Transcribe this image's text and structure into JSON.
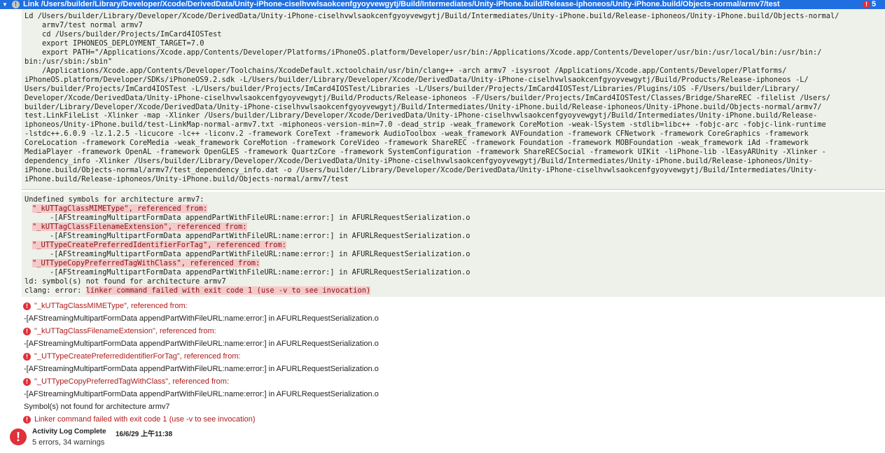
{
  "header": {
    "disclosure": "▼",
    "title": "Link /Users/builder/Library/Developer/Xcode/DerivedData/Unity-iPhone-ciselhvwlsaokcenfgyoyvewgytj/Build/Intermediates/Unity-iPhone.build/Release-iphoneos/Unity-iPhone.build/Objects-normal/armv7/test",
    "warning_glyph": "!",
    "error_glyph": "!",
    "error_count": "5"
  },
  "command_lines": [
    "Ld /Users/builder/Library/Developer/Xcode/DerivedData/Unity-iPhone-ciselhvwlsaokcenfgyoyvewgytj/Build/Intermediates/Unity-iPhone.build/Release-iphoneos/Unity-iPhone.build/Objects-normal/",
    "    armv7/test normal armv7",
    "    cd /Users/builder/Projects/ImCard4IOSTest",
    "    export IPHONEOS_DEPLOYMENT_TARGET=7.0",
    "    export PATH=\"/Applications/Xcode.app/Contents/Developer/Platforms/iPhoneOS.platform/Developer/usr/bin:/Applications/Xcode.app/Contents/Developer/usr/bin:/usr/local/bin:/usr/bin:/",
    "bin:/usr/sbin:/sbin\"",
    "    /Applications/Xcode.app/Contents/Developer/Toolchains/XcodeDefault.xctoolchain/usr/bin/clang++ -arch armv7 -isysroot /Applications/Xcode.app/Contents/Developer/Platforms/",
    "iPhoneOS.platform/Developer/SDKs/iPhoneOS9.2.sdk -L/Users/builder/Library/Developer/Xcode/DerivedData/Unity-iPhone-ciselhvwlsaokcenfgyoyvewgytj/Build/Products/Release-iphoneos -L/",
    "Users/builder/Projects/ImCard4IOSTest -L/Users/builder/Projects/ImCard4IOSTest/Libraries -L/Users/builder/Projects/ImCard4IOSTest/Libraries/Plugins/iOS -F/Users/builder/Library/",
    "Developer/Xcode/DerivedData/Unity-iPhone-ciselhvwlsaokcenfgyoyvewgytj/Build/Products/Release-iphoneos -F/Users/builder/Projects/ImCard4IOSTest/Classes/Bridge/ShareREC -filelist /Users/",
    "builder/Library/Developer/Xcode/DerivedData/Unity-iPhone-ciselhvwlsaokcenfgyoyvewgytj/Build/Intermediates/Unity-iPhone.build/Release-iphoneos/Unity-iPhone.build/Objects-normal/armv7/",
    "test.LinkFileList -Xlinker -map -Xlinker /Users/builder/Library/Developer/Xcode/DerivedData/Unity-iPhone-ciselhvwlsaokcenfgyoyvewgytj/Build/Intermediates/Unity-iPhone.build/Release-",
    "iphoneos/Unity-iPhone.build/test-LinkMap-normal-armv7.txt -miphoneos-version-min=7.0 -dead_strip -weak_framework CoreMotion -weak-lSystem -stdlib=libc++ -fobjc-arc -fobjc-link-runtime",
    "-lstdc++.6.0.9 -lz.1.2.5 -licucore -lc++ -liconv.2 -framework CoreText -framework AudioToolbox -weak_framework AVFoundation -framework CFNetwork -framework CoreGraphics -framework",
    "CoreLocation -framework CoreMedia -weak_framework CoreMotion -framework CoreVideo -framework ShareREC -framework Foundation -framework MOBFoundation -weak_framework iAd -framework",
    "MediaPlayer -framework OpenAL -framework OpenGLES -framework QuartzCore -framework SystemConfiguration -framework ShareRECSocial -framework UIKit -liPhone-lib -lEasyARUnity -Xlinker -",
    "dependency_info -Xlinker /Users/builder/Library/Developer/Xcode/DerivedData/Unity-iPhone-ciselhvwlsaokcenfgyoyvewgytj/Build/Intermediates/Unity-iPhone.build/Release-iphoneos/Unity-",
    "iPhone.build/Objects-normal/armv7/test_dependency_info.dat -o /Users/builder/Library/Developer/Xcode/DerivedData/Unity-iPhone-ciselhvwlsaokcenfgyoyvewgytj/Build/Intermediates/Unity-",
    "iPhone.build/Release-iphoneos/Unity-iPhone.build/Objects-normal/armv7/test"
  ],
  "undefined_block": {
    "heading": "Undefined symbols for architecture armv7:",
    "symbols": [
      {
        "symbol": "\"_kUTTagClassMIMEType\", referenced from:",
        "ref": "-[AFStreamingMultipartFormData appendPartWithFileURL:name:error:] in AFURLRequestSerialization.o"
      },
      {
        "symbol": "\"_kUTTagClassFilenameExtension\", referenced from:",
        "ref": "-[AFStreamingMultipartFormData appendPartWithFileURL:name:error:] in AFURLRequestSerialization.o"
      },
      {
        "symbol": "\"_UTTypeCreatePreferredIdentifierForTag\", referenced from:",
        "ref": "-[AFStreamingMultipartFormData appendPartWithFileURL:name:error:] in AFURLRequestSerialization.o"
      },
      {
        "symbol": "\"_UTTypeCopyPreferredTagWithClass\", referenced from:",
        "ref": "-[AFStreamingMultipartFormData appendPartWithFileURL:name:error:] in AFURLRequestSerialization.o"
      }
    ],
    "ld_line": "ld: symbol(s) not found for architecture armv7",
    "clang_prefix": "clang: error: ",
    "clang_error": "linker command failed with exit code 1 (use -v to see invocation)"
  },
  "issues": [
    {
      "type": "error",
      "text": "\"_kUTTagClassMIMEType\", referenced from:"
    },
    {
      "type": "plain",
      "text": "-[AFStreamingMultipartFormData appendPartWithFileURL:name:error:] in AFURLRequestSerialization.o"
    },
    {
      "type": "error",
      "text": "\"_kUTTagClassFilenameExtension\", referenced from:"
    },
    {
      "type": "plain",
      "text": "-[AFStreamingMultipartFormData appendPartWithFileURL:name:error:] in AFURLRequestSerialization.o"
    },
    {
      "type": "error",
      "text": "\"_UTTypeCreatePreferredIdentifierForTag\", referenced from:"
    },
    {
      "type": "plain",
      "text": "-[AFStreamingMultipartFormData appendPartWithFileURL:name:error:] in AFURLRequestSerialization.o"
    },
    {
      "type": "error",
      "text": "\"_UTTypeCopyPreferredTagWithClass\", referenced from:"
    },
    {
      "type": "plain",
      "text": "-[AFStreamingMultipartFormData appendPartWithFileURL:name:error:] in AFURLRequestSerialization.o"
    },
    {
      "type": "plain",
      "text": "Symbol(s) not found for architecture armv7"
    },
    {
      "type": "error",
      "text": "Linker command failed with exit code 1 (use -v to see invocation)"
    }
  ],
  "footer": {
    "icon": "!",
    "title": "Activity Log Complete",
    "date": "16/6/29 上午11:38",
    "summary": "5 errors, 34 warnings"
  },
  "icons": {
    "disclosure": "disclosure-triangle-icon",
    "warning": "warning-icon",
    "error": "error-icon"
  },
  "colors": {
    "title_bar": "#1f6fe0",
    "log_background": "#eef1ea",
    "highlight": "#f4c9c9",
    "error_red": "#e0303a",
    "error_text": "#b11a1a"
  }
}
